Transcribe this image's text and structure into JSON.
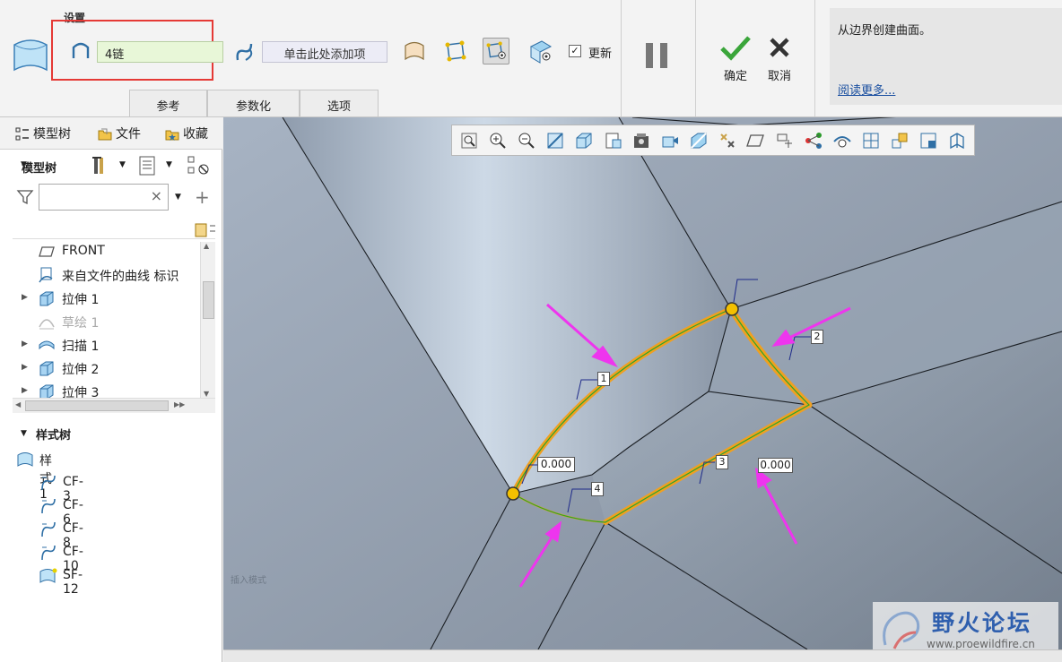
{
  "dashboard": {
    "setup_label": "设置",
    "chain_value": "4链",
    "add_item_placeholder": "单击此处添加项",
    "update_label": "更新",
    "update_checked": "✓",
    "ok_label": "确定",
    "cancel_label": "取消",
    "tabs": [
      {
        "label": "参考"
      },
      {
        "label": "参数化"
      },
      {
        "label": "选项"
      }
    ],
    "help_text": "从边界创建曲面。",
    "help_link": "阅读更多..."
  },
  "navigator": {
    "tabs": [
      {
        "label": "模型树",
        "icon": "model-tree-icon"
      },
      {
        "label": "文件",
        "icon": "folder-icon"
      },
      {
        "label": "收藏",
        "icon": "favorites-icon"
      }
    ],
    "tree_title": "模型树",
    "filter_clear": "×",
    "items": [
      {
        "label": "FRONT",
        "icon": "datum-plane-icon",
        "expandable": false,
        "dim": false
      },
      {
        "label": "来自文件的曲线 标识",
        "icon": "curve-from-file-icon",
        "expandable": false,
        "dim": false
      },
      {
        "label": "拉伸 1",
        "icon": "extrude-icon",
        "expandable": true,
        "dim": false
      },
      {
        "label": "草绘 1",
        "icon": "sketch-icon",
        "expandable": false,
        "dim": true
      },
      {
        "label": "扫描 1",
        "icon": "sweep-icon",
        "expandable": true,
        "dim": false
      },
      {
        "label": "拉伸 2",
        "icon": "extrude-icon",
        "expandable": true,
        "dim": false
      },
      {
        "label": "拉伸 3",
        "icon": "extrude-icon",
        "expandable": true,
        "dim": false
      }
    ],
    "style_title": "样式树",
    "style_items": [
      {
        "label": "样式 1",
        "icon": "style-icon"
      },
      {
        "label": "CF-3",
        "icon": "curve-feature-icon"
      },
      {
        "label": "CF-6",
        "icon": "curve-feature-icon"
      },
      {
        "label": "CF-8",
        "icon": "curve-feature-icon"
      },
      {
        "label": "CF-10",
        "icon": "curve-feature-icon"
      },
      {
        "label": "SF-12",
        "icon": "surface-feature-icon"
      }
    ]
  },
  "viewport": {
    "dimension_label_top": "0.000",
    "dimension_label_left": "0.000",
    "chain_tags": [
      "1",
      "2",
      "3",
      "4"
    ],
    "insert_mode": "插入模式",
    "accent_arrow_color": "#ee35ee",
    "chain_color": "#f0a020",
    "watermark_title": "野火论坛",
    "watermark_url": "www.proewildfire.cn"
  }
}
